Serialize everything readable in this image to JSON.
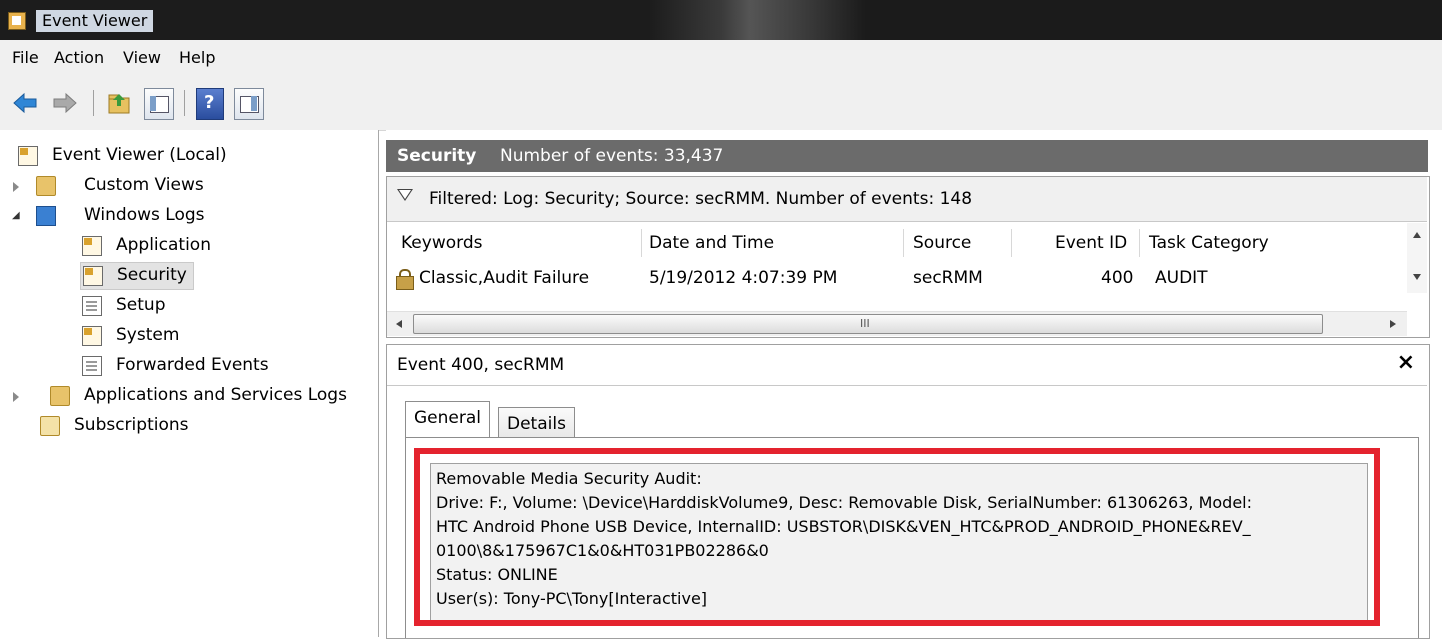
{
  "window": {
    "title": "Event Viewer",
    "app_icon": "event-viewer-icon"
  },
  "menu": {
    "file": "File",
    "action": "Action",
    "view": "View",
    "help": "Help"
  },
  "toolbar": {
    "icons": [
      "back-arrow-icon",
      "forward-arrow-icon",
      "up-folder-icon",
      "show-hide-tree-icon",
      "help-icon",
      "show-hide-action-pane-icon"
    ]
  },
  "tree": {
    "root": "Event Viewer (Local)",
    "custom_views": "Custom Views",
    "windows_logs": "Windows Logs",
    "application": "Application",
    "security": "Security",
    "setup": "Setup",
    "system": "System",
    "forwarded": "Forwarded Events",
    "app_services": "Applications and Services Logs",
    "subscriptions": "Subscriptions"
  },
  "log_header": {
    "name": "Security",
    "count": "Number of events: 33,437"
  },
  "filter": {
    "text": "Filtered: Log: Security; Source: secRMM. Number of events: 148"
  },
  "columns": {
    "keywords": "Keywords",
    "date": "Date and Time",
    "source": "Source",
    "event_id": "Event ID",
    "task": "Task Category"
  },
  "events": [
    {
      "keywords": "Classic,Audit Failure",
      "date": "5/19/2012 4:07:39 PM",
      "source": "secRMM",
      "event_id": "400",
      "task": "AUDIT"
    }
  ],
  "scrollbar": {
    "grip": "III"
  },
  "detail": {
    "title": "Event 400, secRMM",
    "close": "×",
    "tab_general": "General",
    "tab_details": "Details",
    "lines": [
      "Removable Media Security Audit:",
      "Drive: F:, Volume: \\Device\\HarddiskVolume9, Desc: Removable Disk, SerialNumber: 61306263, Model:",
      "HTC Android Phone USB Device, InternalID: USBSTOR\\DISK&VEN_HTC&PROD_ANDROID_PHONE&REV_",
      "0100\\8&175967C1&0&HT031PB02286&0",
      "Status: ONLINE",
      "User(s): Tony-PC\\Tony[Interactive]"
    ]
  },
  "colors": {
    "highlight_border": "#e4232e",
    "header_bg": "#6b6b6b"
  }
}
